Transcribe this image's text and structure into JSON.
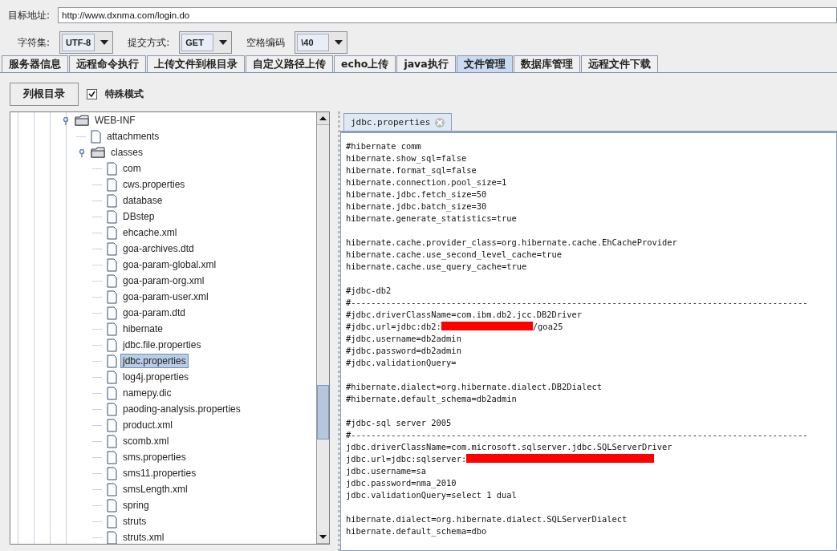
{
  "target": {
    "label": "目标地址:",
    "value": "http://www.dxnma.com/login.do"
  },
  "options": [
    {
      "label": "字符集:",
      "value": "UTF-8"
    },
    {
      "label": "提交方式:",
      "value": "GET"
    },
    {
      "label": "空格编码",
      "value": "\\40"
    }
  ],
  "tabs": [
    {
      "label": "服务器信息",
      "selected": false
    },
    {
      "label": "远程命令执行",
      "selected": false
    },
    {
      "label": "上传文件到根目录",
      "selected": false
    },
    {
      "label": "自定义路径上传",
      "selected": false
    },
    {
      "label": "echo上传",
      "selected": false
    },
    {
      "label": "java执行",
      "selected": false
    },
    {
      "label": "文件管理",
      "selected": true
    },
    {
      "label": "数据库管理",
      "selected": false
    },
    {
      "label": "远程文件下载",
      "selected": false
    }
  ],
  "toolbar": {
    "button": "列根目录",
    "checkbox": {
      "label": "特殊模式",
      "checked": true
    }
  },
  "tree": [
    {
      "name": "WEB-INF",
      "kind": "folder",
      "selected": false,
      "children": [
        {
          "name": "attachments",
          "kind": "file",
          "selected": false
        },
        {
          "name": "classes",
          "kind": "folder",
          "selected": false,
          "children": [
            {
              "name": "com",
              "kind": "file",
              "selected": false
            },
            {
              "name": "cws.properties",
              "kind": "file",
              "selected": false
            },
            {
              "name": "database",
              "kind": "file",
              "selected": false
            },
            {
              "name": "DBstep",
              "kind": "file",
              "selected": false
            },
            {
              "name": "ehcache.xml",
              "kind": "file",
              "selected": false
            },
            {
              "name": "goa-archives.dtd",
              "kind": "file",
              "selected": false
            },
            {
              "name": "goa-param-global.xml",
              "kind": "file",
              "selected": false
            },
            {
              "name": "goa-param-org.xml",
              "kind": "file",
              "selected": false
            },
            {
              "name": "goa-param-user.xml",
              "kind": "file",
              "selected": false
            },
            {
              "name": "goa-param.dtd",
              "kind": "file",
              "selected": false
            },
            {
              "name": "hibernate",
              "kind": "file",
              "selected": false
            },
            {
              "name": "jdbc.file.properties",
              "kind": "file",
              "selected": false
            },
            {
              "name": "jdbc.properties",
              "kind": "file",
              "selected": true
            },
            {
              "name": "log4j.properties",
              "kind": "file",
              "selected": false
            },
            {
              "name": "namepy.dic",
              "kind": "file",
              "selected": false
            },
            {
              "name": "paoding-analysis.properties",
              "kind": "file",
              "selected": false
            },
            {
              "name": "product.xml",
              "kind": "file",
              "selected": false
            },
            {
              "name": "scomb.xml",
              "kind": "file",
              "selected": false
            },
            {
              "name": "sms.properties",
              "kind": "file",
              "selected": false
            },
            {
              "name": "sms11.properties",
              "kind": "file",
              "selected": false
            },
            {
              "name": "smsLength.xml",
              "kind": "file",
              "selected": false
            },
            {
              "name": "spring",
              "kind": "file",
              "selected": false
            },
            {
              "name": "struts",
              "kind": "file",
              "selected": false
            },
            {
              "name": "struts.xml",
              "kind": "file",
              "selected": false
            }
          ]
        }
      ]
    }
  ],
  "editor": {
    "tab": "jdbc.properties",
    "lines": [
      {
        "kind": "code",
        "parts": [
          {
            "kind": "text",
            "text": "#hibernate comm"
          }
        ]
      },
      {
        "kind": "code",
        "parts": [
          {
            "kind": "text",
            "text": "hibernate.show_sql=false"
          }
        ]
      },
      {
        "kind": "code",
        "parts": [
          {
            "kind": "text",
            "text": "hibernate.format_sql=false"
          }
        ]
      },
      {
        "kind": "code",
        "parts": [
          {
            "kind": "text",
            "text": "hibernate.connection.pool_size=1"
          }
        ]
      },
      {
        "kind": "code",
        "parts": [
          {
            "kind": "text",
            "text": "hibernate.jdbc.fetch_size=50"
          }
        ]
      },
      {
        "kind": "code",
        "parts": [
          {
            "kind": "text",
            "text": "hibernate.jdbc.batch_size=30"
          }
        ]
      },
      {
        "kind": "code",
        "parts": [
          {
            "kind": "text",
            "text": "hibernate.generate_statistics=true"
          }
        ]
      },
      {
        "kind": "blank"
      },
      {
        "kind": "code",
        "parts": [
          {
            "kind": "text",
            "text": "hibernate.cache.provider_class=org.hibernate.cache.EhCacheProvider"
          }
        ]
      },
      {
        "kind": "code",
        "parts": [
          {
            "kind": "text",
            "text": "hibernate.cache.use_second_level_cache=true"
          }
        ]
      },
      {
        "kind": "code",
        "parts": [
          {
            "kind": "text",
            "text": "hibernate.cache.use_query_cache=true"
          }
        ]
      },
      {
        "kind": "blank"
      },
      {
        "kind": "code",
        "parts": [
          {
            "kind": "text",
            "text": "#jdbc-db2"
          }
        ]
      },
      {
        "kind": "code",
        "parts": [
          {
            "kind": "text",
            "text": "#-------------------------------------------------------------------------------------------"
          }
        ]
      },
      {
        "kind": "code",
        "parts": [
          {
            "kind": "text",
            "text": "#jdbc.driverClassName=com.ibm.db2.jcc.DB2Driver"
          }
        ]
      },
      {
        "kind": "code",
        "parts": [
          {
            "kind": "text",
            "text": "#jdbc.url=jdbc:db2:"
          },
          {
            "kind": "redaction"
          },
          {
            "kind": "text",
            "text": "/goa25"
          }
        ]
      },
      {
        "kind": "code",
        "parts": [
          {
            "kind": "text",
            "text": "#jdbc.username=db2admin"
          }
        ]
      },
      {
        "kind": "code",
        "parts": [
          {
            "kind": "text",
            "text": "#jdbc.password=db2admin"
          }
        ]
      },
      {
        "kind": "code",
        "parts": [
          {
            "kind": "text",
            "text": "#jdbc.validationQuery="
          }
        ]
      },
      {
        "kind": "blank"
      },
      {
        "kind": "code",
        "parts": [
          {
            "kind": "text",
            "text": "#hibernate.dialect=org.hibernate.dialect.DB2Dialect"
          }
        ]
      },
      {
        "kind": "code",
        "parts": [
          {
            "kind": "text",
            "text": "#hibernate.default_schema=db2admin"
          }
        ]
      },
      {
        "kind": "blank"
      },
      {
        "kind": "code",
        "parts": [
          {
            "kind": "text",
            "text": "#jdbc-sql server 2005"
          }
        ]
      },
      {
        "kind": "code",
        "parts": [
          {
            "kind": "text",
            "text": "#-------------------------------------------------------------------------------------------"
          }
        ]
      },
      {
        "kind": "code",
        "parts": [
          {
            "kind": "text",
            "text": "jdbc.driverClassName=com.microsoft.sqlserver.jdbc.SQLServerDriver"
          }
        ]
      },
      {
        "kind": "code",
        "parts": [
          {
            "kind": "text",
            "text": "jdbc.url=jdbc:sqlserver:"
          },
          {
            "kind": "long_redaction"
          }
        ]
      },
      {
        "kind": "code",
        "parts": [
          {
            "kind": "text",
            "text": "jdbc.username=sa"
          }
        ]
      },
      {
        "kind": "code",
        "parts": [
          {
            "kind": "text",
            "text": "jdbc.password=nma_2010"
          }
        ]
      },
      {
        "kind": "code",
        "parts": [
          {
            "kind": "text",
            "text": "jdbc.validationQuery=select 1 dual"
          }
        ]
      },
      {
        "kind": "blank"
      },
      {
        "kind": "code",
        "parts": [
          {
            "kind": "text",
            "text": "hibernate.dialect=org.hibernate.dialect.SQLServerDialect"
          }
        ]
      },
      {
        "kind": "code",
        "parts": [
          {
            "kind": "text",
            "text": "hibernate.default_schema=dbo"
          }
        ]
      }
    ]
  }
}
